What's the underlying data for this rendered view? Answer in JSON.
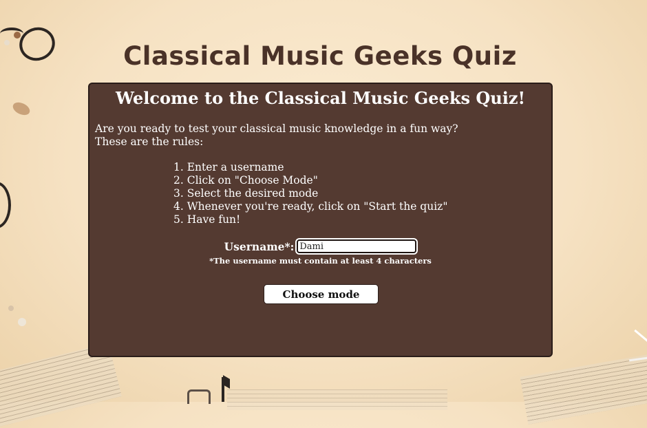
{
  "header": {
    "title": "Classical Music Geeks Quiz"
  },
  "panel": {
    "heading": "Welcome to the Classical Music Geeks Quiz!",
    "intro_line1": "Are you ready to test your classical music knowledge in a fun way?",
    "intro_line2": "These are the rules:",
    "rules": [
      "1. Enter a username",
      "2. Click on \"Choose Mode\"",
      "3. Select the desired mode",
      "4. Whenever you're ready, click on \"Start the quiz\"",
      "5. Have fun!"
    ]
  },
  "form": {
    "username_label": "Username*:",
    "username_value": "Dami",
    "hint": "*The username must contain at least 4 characters",
    "choose_mode_label": "Choose mode"
  },
  "colors": {
    "panel_bg": "#543a31",
    "title": "#4a3228",
    "background": "#f6e2c3"
  }
}
